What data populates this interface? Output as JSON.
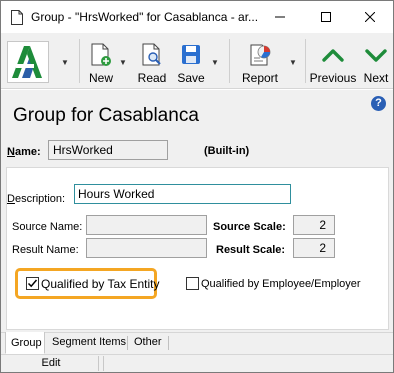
{
  "window": {
    "title": "Group - \"HrsWorked\" for Casablanca - ar..."
  },
  "toolbar": {
    "new_label": "New",
    "read_label": "Read",
    "save_label": "Save",
    "report_label": "Report",
    "previous_label": "Previous",
    "next_label": "Next"
  },
  "page": {
    "heading": "Group for Casablanca",
    "help": "?"
  },
  "form": {
    "name_label_accel": "N",
    "name_label_rest": "ame:",
    "name_value": "HrsWorked",
    "builtin_text": "(Built-in)",
    "description_label_accel": "D",
    "description_label_rest": "escription:",
    "description_value": "Hours Worked",
    "source_name_label": "Source Name:",
    "source_name_value": "",
    "result_name_label": "Result Name:",
    "result_name_value": "",
    "source_scale_label": "Source Scale:",
    "source_scale_value": "2",
    "result_scale_label": "Result Scale:",
    "result_scale_value": "2",
    "qualified_tax_label": "Qualified by Tax Entity",
    "qualified_tax_checked": true,
    "qualified_emp_label": "Qualified by Employee/Employer",
    "qualified_emp_checked": false
  },
  "tabs": [
    {
      "label": "Group",
      "active": true
    },
    {
      "label": "Segment Items",
      "active": false
    },
    {
      "label": "Other",
      "active": false
    }
  ],
  "status": {
    "mode": "Edit"
  },
  "colors": {
    "highlight": "#f4a623",
    "accent_green": "#1e8c3a",
    "help_blue": "#2a5fb5"
  }
}
